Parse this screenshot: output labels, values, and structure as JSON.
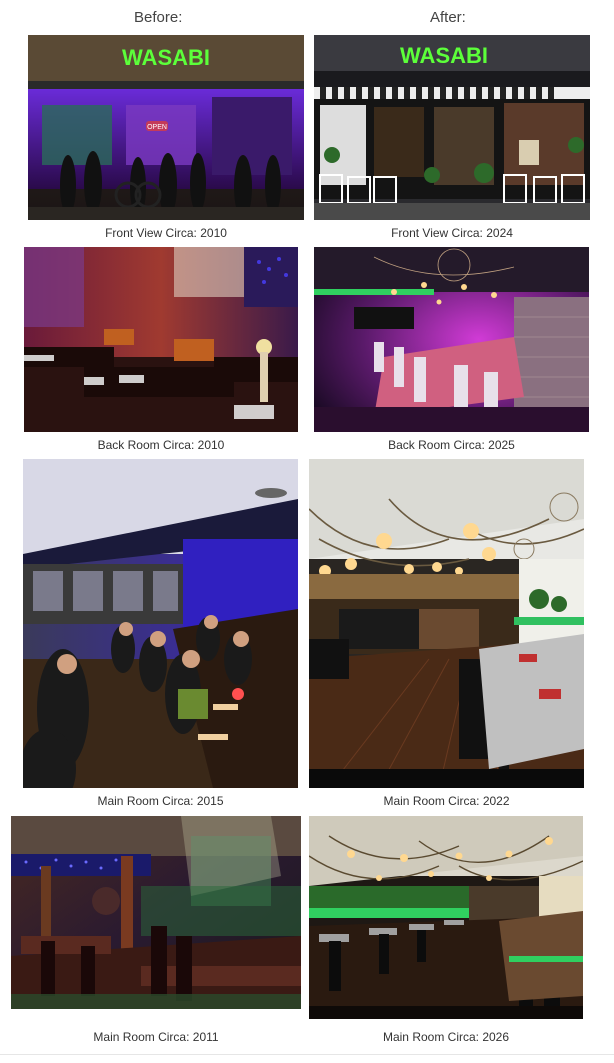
{
  "headers": {
    "before": "Before:",
    "after": "After:"
  },
  "sign_text": "WASABI",
  "storefront_sign": "OPEN",
  "panels": [
    {
      "caption": "Front View Circa: 2010"
    },
    {
      "caption": "Front View Circa: 2024"
    },
    {
      "caption": "Back Room Circa: 2010"
    },
    {
      "caption": "Back Room Circa: 2025"
    },
    {
      "caption": "Main Room Circa: 2015"
    },
    {
      "caption": "Main Room Circa: 2022"
    },
    {
      "caption": "Main Room Circa: 2011"
    },
    {
      "caption": "Main Room Circa: 2026"
    }
  ],
  "colors": {
    "sign_green": "#5CFF3A",
    "neon_purple": "#8A2BE2",
    "magenta": "#D13BD6",
    "caption_text": "#333333"
  }
}
